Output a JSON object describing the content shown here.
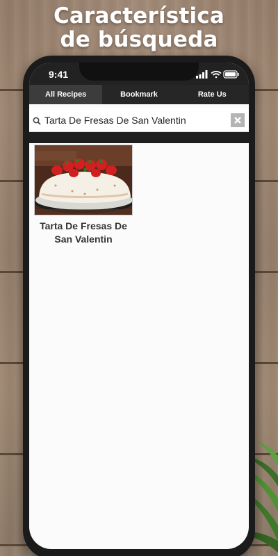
{
  "promo": {
    "line1": "Característica",
    "line2": "de búsqueda"
  },
  "status_bar": {
    "time": "9:41",
    "icons": [
      "signal-icon",
      "wifi-icon",
      "battery-icon"
    ]
  },
  "tabs": [
    {
      "label": "All Recipes",
      "active": true
    },
    {
      "label": "Bookmark",
      "active": false
    },
    {
      "label": "Rate Us",
      "active": false
    }
  ],
  "search": {
    "value": "Tarta De Fresas De San Valentin",
    "search_icon": "search-icon",
    "clear_icon": "close-icon"
  },
  "results": [
    {
      "title": "Tarta De Fresas De San Valentin",
      "image": "strawberry-meringue-cake-photo"
    }
  ],
  "colors": {
    "header_bar": "#262626",
    "active_tab": "#3c3c3c",
    "screen_bg": "#fbfbfb",
    "card_text": "#333333"
  }
}
